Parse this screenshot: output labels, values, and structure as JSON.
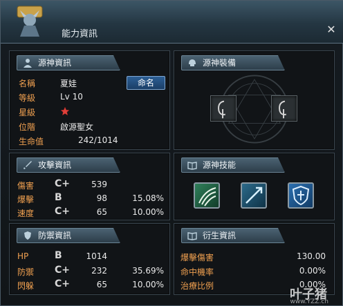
{
  "window": {
    "title": "能力資訊",
    "close_icon": "close-icon"
  },
  "spirit_info": {
    "header": "源神資訊",
    "rows": [
      {
        "label": "名稱",
        "value": "夏娃"
      },
      {
        "label": "等級",
        "value": "Lv 10"
      },
      {
        "label": "星級",
        "value": ""
      },
      {
        "label": "位階",
        "value": "啟源聖女"
      },
      {
        "label": "生命值",
        "value": "242/1014"
      }
    ],
    "name_button": "命名",
    "stars": 1
  },
  "spirit_equip": {
    "header": "源神裝備"
  },
  "attack_info": {
    "header": "攻擊資訊",
    "rows": [
      {
        "label": "傷害",
        "grade": "C+",
        "value": "539",
        "percent": ""
      },
      {
        "label": "爆擊",
        "grade": "B",
        "value": "98",
        "percent": "15.08%"
      },
      {
        "label": "速度",
        "grade": "C+",
        "value": "65",
        "percent": "10.00%"
      }
    ]
  },
  "spirit_skills": {
    "header": "源神技能"
  },
  "defense_info": {
    "header": "防禦資訊",
    "rows": [
      {
        "label": "HP",
        "grade": "B",
        "value": "1014",
        "percent": ""
      },
      {
        "label": "防禦",
        "grade": "C+",
        "value": "232",
        "percent": "35.69%"
      },
      {
        "label": "閃躲",
        "grade": "C+",
        "value": "65",
        "percent": "10.00%"
      }
    ]
  },
  "derived_info": {
    "header": "衍生資訊",
    "rows": [
      {
        "label": "爆擊傷害",
        "value": "130.00"
      },
      {
        "label": "命中機率",
        "value": "0.00%"
      },
      {
        "label": "治療比例",
        "value": "0.00%"
      }
    ]
  },
  "watermark": {
    "text": "叶子猪",
    "url": "www.YZZ.cn"
  },
  "colors": {
    "label": "#f0a050",
    "accent": "#2d5f95"
  }
}
